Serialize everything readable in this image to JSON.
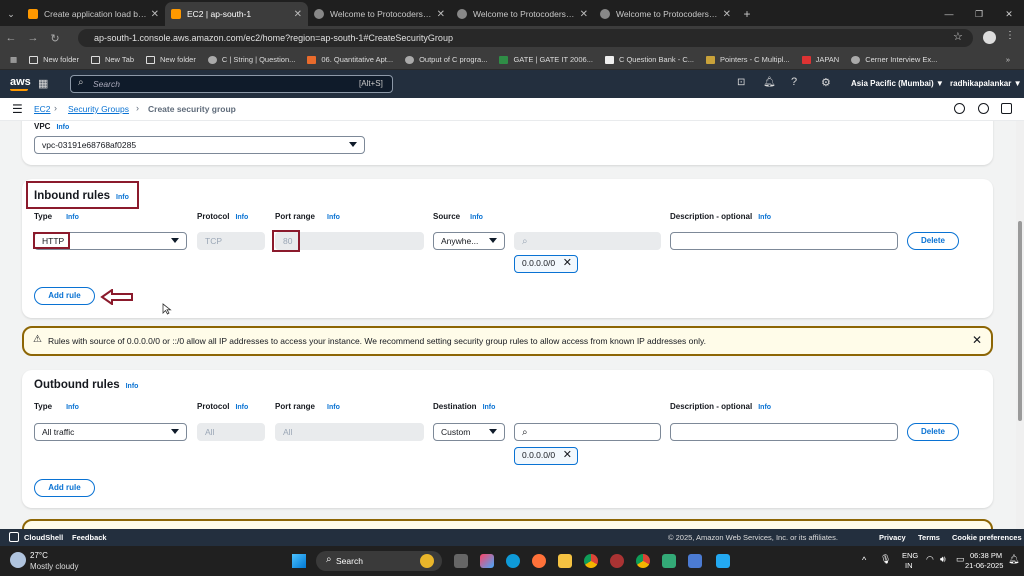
{
  "browser": {
    "tabs": [
      {
        "title": "Create application load balanc",
        "active": false
      },
      {
        "title": "EC2 | ap-south-1",
        "active": true
      },
      {
        "title": "Welcome to Protocoderspoint",
        "active": false
      },
      {
        "title": "Welcome to Protocoderspoint",
        "active": false
      },
      {
        "title": "Welcome to Protocoderspoint",
        "active": false
      }
    ],
    "url": "ap-south-1.console.aws.amazon.com/ec2/home?region=ap-south-1#CreateSecurityGroup",
    "bookmarks": [
      "New folder",
      "New Tab",
      "New folder",
      "C | String | Question...",
      "06. Quantitative Apt...",
      "Output of C progra...",
      "GATE | GATE IT 2006...",
      "C Question Bank - C...",
      "Pointers - C Multipl...",
      "JAPAN",
      "Cerner Interview Ex..."
    ]
  },
  "aws_nav": {
    "logo": "aws",
    "search_placeholder": "Search",
    "search_shortcut": "[Alt+S]",
    "region": "Asia Pacific (Mumbai) ▼",
    "user": "radhikapalankar ▼"
  },
  "breadcrumb": {
    "root": "EC2",
    "parent": "Security Groups",
    "current": "Create security group"
  },
  "vpc": {
    "label": "VPC",
    "info": "Info",
    "value": "vpc-03191e68768af0285"
  },
  "inbound": {
    "title": "Inbound rules",
    "info": "Info",
    "headers": {
      "type": "Type",
      "protocol": "Protocol",
      "port": "Port range",
      "source": "Source",
      "desc": "Description - optional"
    },
    "row": {
      "type": "HTTP",
      "protocol": "TCP",
      "port": "80",
      "source": "Anywhe...",
      "cidr": "0.0.0.0/0",
      "delete": "Delete"
    },
    "add_rule": "Add rule"
  },
  "warning": {
    "text": "Rules with source of 0.0.0.0/0 or ::/0 allow all IP addresses to access your instance. We recommend setting security group rules to allow access from known IP addresses only."
  },
  "outbound": {
    "title": "Outbound rules",
    "info": "Info",
    "headers": {
      "type": "Type",
      "protocol": "Protocol",
      "port": "Port range",
      "dest": "Destination",
      "desc": "Description - optional"
    },
    "row": {
      "type": "All traffic",
      "protocol": "All",
      "port": "All",
      "dest": "Custom",
      "cidr": "0.0.0.0/0",
      "delete": "Delete"
    },
    "add_rule": "Add rule"
  },
  "footer": {
    "cloudshell": "CloudShell",
    "feedback": "Feedback",
    "copyright": "© 2025, Amazon Web Services, Inc. or its affiliates.",
    "privacy": "Privacy",
    "terms": "Terms",
    "cookies": "Cookie preferences"
  },
  "taskbar": {
    "temp": "27°C",
    "weather": "Mostly cloudy",
    "search": "Search",
    "lang1": "ENG",
    "lang2": "IN",
    "time": "06:38 PM",
    "date": "21-06-2025"
  },
  "colors": {
    "accent": "#0972d3",
    "nav": "#232f3e",
    "highlight": "#8b1a2c",
    "warning_bg": "#fffce9",
    "warning_border": "#8d6605"
  }
}
